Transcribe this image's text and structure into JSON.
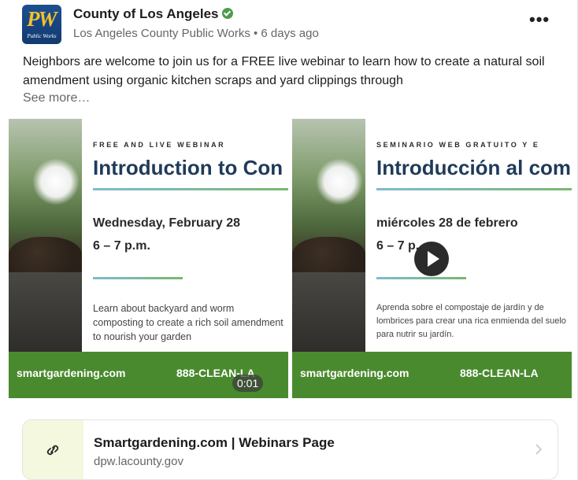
{
  "post": {
    "org_name": "County of Los Angeles",
    "byline": "Los Angeles County Public Works • 6 days ago",
    "avatar_text": "PW",
    "avatar_subtext": "Public Works",
    "more_icon": "ellipsis-icon",
    "text": "Neighbors are welcome to join us for a FREE live webinar to learn how to create a natural soil amendment using organic kitchen scraps and yard clippings through",
    "see_more": "See more…"
  },
  "media": [
    {
      "kicker": "FREE AND LIVE WEBINAR",
      "heading": "Introduction to Con",
      "date": "Wednesday, February 28",
      "time": "6 – 7 p.m.",
      "description": "Learn about backyard and worm composting to create a rich soil amendment to nourish your garden",
      "site": "smartgardening.com",
      "phone": "888-CLEAN-LA"
    },
    {
      "kicker": "SEMINARIO WEB GRATUITO Y E",
      "heading": "Introducción al com",
      "date": "miércoles 28 de febrero",
      "time": "6 – 7 p.",
      "description": "Aprenda sobre el compostaje de jardín y de lombrices para crear una rica enmienda del suelo para nutrir su jardín.",
      "site": "smartgardening.com",
      "phone": "888-CLEAN-LA"
    }
  ],
  "video": {
    "duration": "0:01"
  },
  "link_preview": {
    "title": "Smartgardening.com | Webinars Page",
    "domain": "dpw.lacounty.gov"
  },
  "colors": {
    "accent_green": "#4a8a2e",
    "heading_navy": "#1f3b5a",
    "verified_green": "#4e9c4e"
  }
}
